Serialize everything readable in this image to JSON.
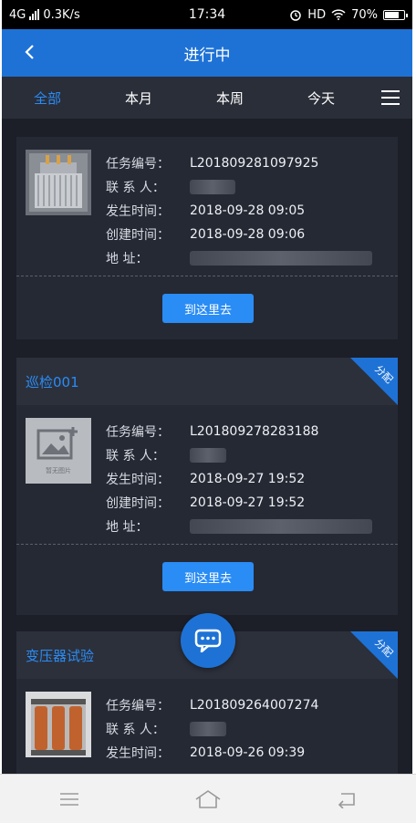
{
  "status_bar": {
    "network": "4G",
    "speed": "0.3K/s",
    "time": "17:34",
    "hd": "HD",
    "battery": "70%"
  },
  "nav": {
    "title": "进行中",
    "back_icon": "chevron-left-icon"
  },
  "tabs": [
    {
      "label": "全部",
      "active": true
    },
    {
      "label": "本月",
      "active": false
    },
    {
      "label": "本周",
      "active": false
    },
    {
      "label": "今天",
      "active": false
    }
  ],
  "labels": {
    "task_no": "任务编号：",
    "contact": "联 系 人：",
    "occur_time": "发生时间：",
    "create_time": "创建时间：",
    "address": "地      址："
  },
  "cards": [
    {
      "title": "",
      "badge": "",
      "task_no": "L201809281097925",
      "occur_time": "2018-09-28 09:05",
      "create_time": "2018-09-28 09:06",
      "button": "到这里去"
    },
    {
      "title": "巡检001",
      "badge": "分配",
      "task_no": "L201809278283188",
      "occur_time": "2018-09-27 19:52",
      "create_time": "2018-09-27 19:52",
      "button": "到这里去",
      "placeholder_text": "暂无图片"
    },
    {
      "title": "变压器试验",
      "badge": "分配",
      "task_no": "L201809264007274",
      "occur_time": "2018-09-26 09:39",
      "create_time": "",
      "button": ""
    }
  ],
  "colors": {
    "accent": "#2a8cf5",
    "navbar": "#1e72d6",
    "background": "#1c1f27",
    "card": "#252934"
  }
}
